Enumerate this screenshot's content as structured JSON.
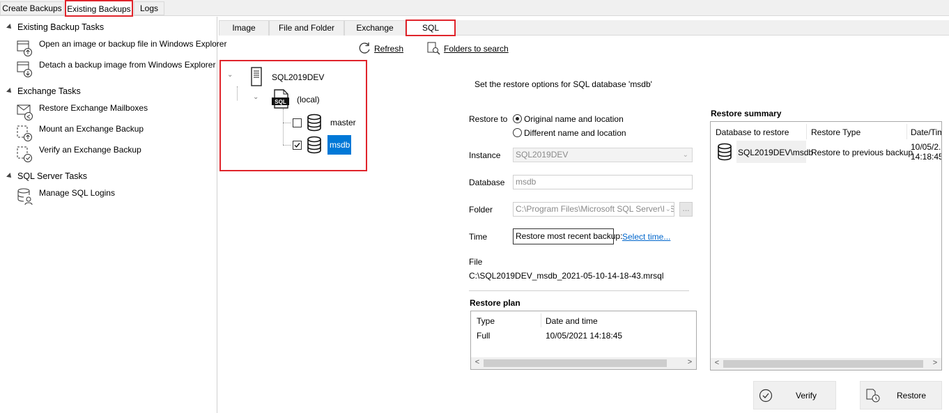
{
  "top_tabs": [
    "Create Backups",
    "Existing Backups",
    "Logs"
  ],
  "left_pane": {
    "sections": [
      {
        "title": "Existing Backup Tasks",
        "items": [
          "Open an image or backup file in Windows Explorer",
          "Detach a backup image from Windows Explorer"
        ]
      },
      {
        "title": "Exchange Tasks",
        "items": [
          "Restore Exchange Mailboxes",
          "Mount an Exchange Backup",
          "Verify an Exchange Backup"
        ]
      },
      {
        "title": "SQL Server Tasks",
        "items": [
          "Manage SQL Logins"
        ]
      }
    ]
  },
  "sub_tabs": [
    "Image",
    "File and Folder",
    "Exchange",
    "SQL"
  ],
  "toolbar": {
    "refresh": "Refresh",
    "folders": "Folders to search"
  },
  "tree": {
    "server": "SQL2019DEV",
    "instance": "(local)",
    "databases": [
      {
        "name": "master",
        "checked": false
      },
      {
        "name": "msdb",
        "checked": true,
        "selected": true
      }
    ]
  },
  "options": {
    "header": "Set the restore options for SQL database 'msdb'",
    "restore_to_label": "Restore to",
    "radio_original": "Original name and location",
    "radio_different": "Different name and location",
    "instance_label": "Instance",
    "instance_value": "SQL2019DEV",
    "database_label": "Database",
    "database_value": "msdb",
    "folder_label": "Folder",
    "folder_value": "C:\\Program Files\\Microsoft SQL Server\\MSS",
    "browse_label": "...",
    "time_label": "Time",
    "time_value": "Restore most recent backup:",
    "select_time": "Select time...",
    "file_label": "File",
    "file_value": "C:\\SQL2019DEV_msdb_2021-05-10-14-18-43.mrsql"
  },
  "restore_plan": {
    "title": "Restore plan",
    "columns": [
      "Type",
      "Date and time"
    ],
    "rows": [
      [
        "Full",
        "10/05/2021 14:18:45"
      ]
    ]
  },
  "restore_summary": {
    "title": "Restore summary",
    "columns": [
      "Database to restore",
      "Restore Type",
      "Date/Tim"
    ],
    "rows": [
      [
        "SQL2019DEV\\msdb",
        "Restore to previous backup",
        "10/05/2...",
        "14:18:45"
      ]
    ]
  },
  "buttons": {
    "verify": "Verify",
    "restore": "Restore"
  }
}
